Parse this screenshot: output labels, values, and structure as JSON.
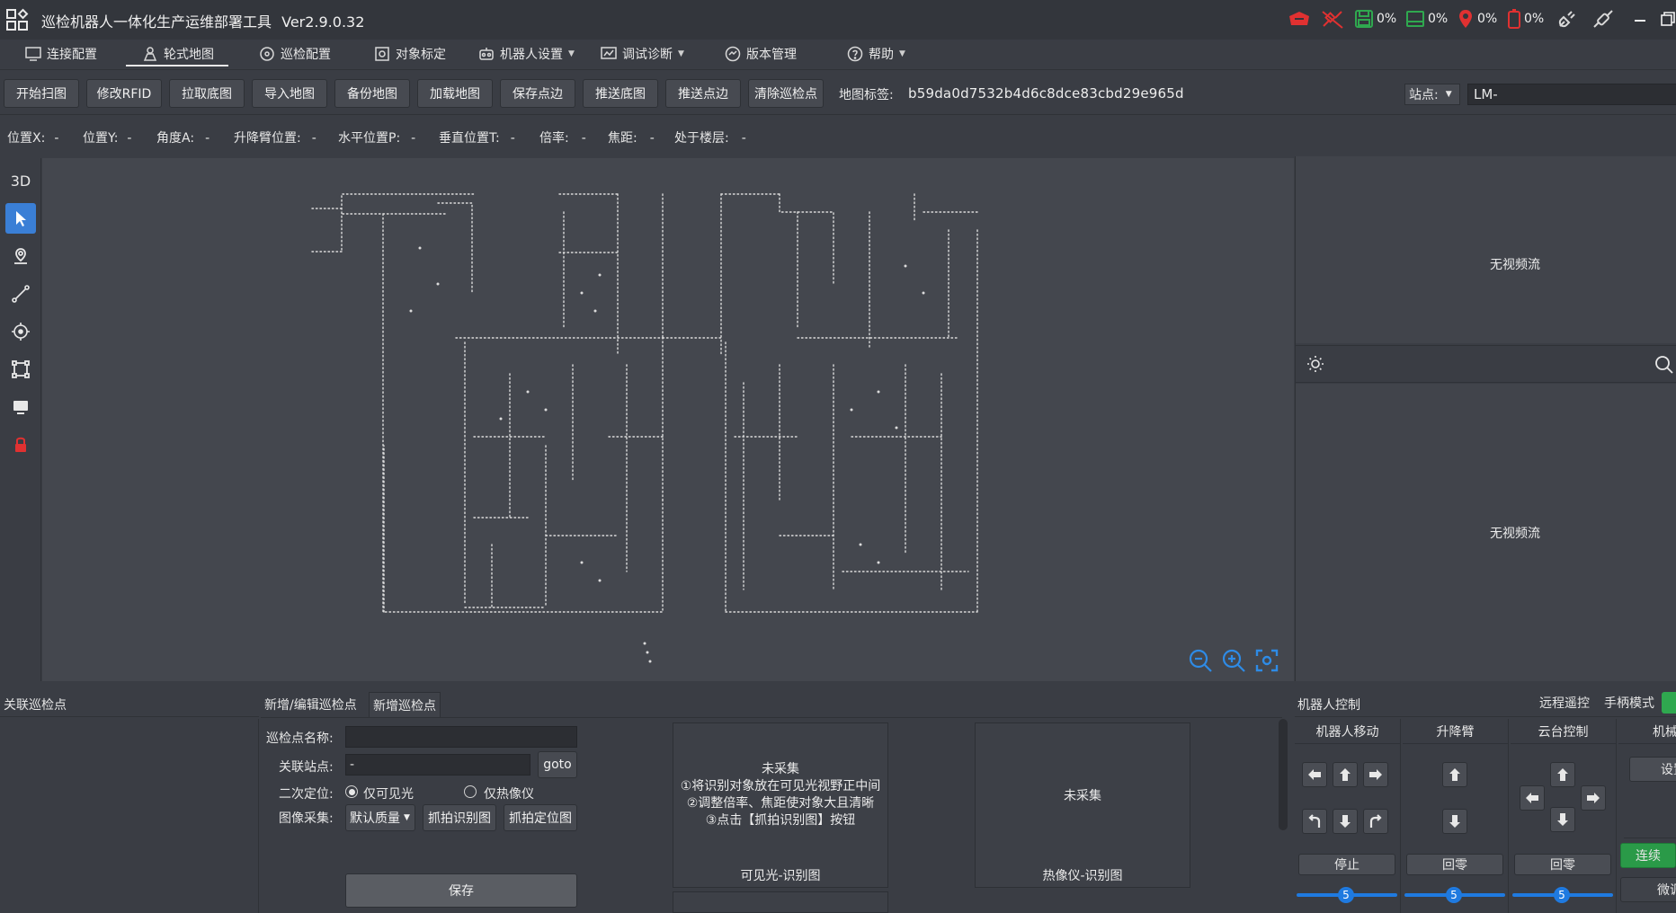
{
  "app": {
    "title": "巡检机器人一体化生产运维部署工具",
    "version": "Ver2.9.0.32"
  },
  "status_icons": [
    {
      "name": "alarm-icon",
      "color": "#e03131"
    },
    {
      "name": "disconnect-icon",
      "color": "#e03131"
    },
    {
      "name": "disk-icon",
      "value": "0%",
      "color": "#2fa84f"
    },
    {
      "name": "memory-icon",
      "value": "0%",
      "color": "#2fa84f"
    },
    {
      "name": "location-pin-icon",
      "value": "0%",
      "color": "#e03131"
    },
    {
      "name": "battery-icon",
      "value": "0%",
      "color": "#e03131"
    },
    {
      "name": "power-plug-icon"
    },
    {
      "name": "link-icon"
    }
  ],
  "menu": [
    {
      "label": "连接配置",
      "icon": "connection-icon"
    },
    {
      "label": "轮式地图",
      "icon": "robot-map-icon",
      "active": true
    },
    {
      "label": "巡检配置",
      "icon": "patrol-config-icon"
    },
    {
      "label": "对象标定",
      "icon": "target-icon"
    },
    {
      "label": "机器人设置",
      "icon": "robot-settings-icon",
      "dropdown": true
    },
    {
      "label": "调试诊断",
      "icon": "debug-icon",
      "dropdown": true
    },
    {
      "label": "版本管理",
      "icon": "version-icon"
    },
    {
      "label": "帮助",
      "icon": "help-icon",
      "dropdown": true
    }
  ],
  "toolbar": {
    "buttons": [
      "开始扫图",
      "修改RFID",
      "拉取底图",
      "导入地图",
      "备份地图",
      "加载地图",
      "保存点边",
      "推送底图",
      "推送点边",
      "清除巡检点"
    ],
    "map_tag_label": "地图标签:",
    "map_tag_value": "b59da0d7532b4d6c8dce83cbd29e965d",
    "station_label": "站点:",
    "station_value": "LM-"
  },
  "status_line": [
    {
      "label": "位置X:",
      "value": "-"
    },
    {
      "label": "位置Y:",
      "value": "-"
    },
    {
      "label": "角度A:",
      "value": "-"
    },
    {
      "label": "升降臂位置:",
      "value": "-"
    },
    {
      "label": "水平位置P:",
      "value": "-"
    },
    {
      "label": "垂直位置T:",
      "value": "-"
    },
    {
      "label": "倍率:",
      "value": "-"
    },
    {
      "label": "焦距:",
      "value": "-"
    },
    {
      "label": "处于楼层:",
      "value": "-"
    }
  ],
  "tools": {
    "view_3d": "3D"
  },
  "video": {
    "top_text": "无视频流",
    "bottom_text": "无视频流"
  },
  "left_panel": {
    "title": "关联巡检点"
  },
  "edit_panel": {
    "tabs": [
      "新增/编辑巡检点",
      "新增巡检点"
    ],
    "name_label": "巡检点名称:",
    "name_value": "",
    "station_label": "关联站点:",
    "station_value": "-",
    "goto_label": "goto",
    "relocate_label": "二次定位:",
    "radio_visible": "仅可见光",
    "radio_thermal": "仅热像仪",
    "capture_label": "图像采集:",
    "quality_value": "默认质量",
    "snap_recog_label": "抓拍识别图",
    "snap_locate_label": "抓拍定位图",
    "save_label": "保存",
    "visible_box": {
      "status": "未采集",
      "line1": "①将识别对象放在可见光视野正中间",
      "line2": "②调整倍率、焦距使对象大且清晰",
      "line3": "③点击【抓拍识别图】按钮",
      "caption": "可见光-识别图"
    },
    "thermal_box": {
      "status": "未采集",
      "caption": "热像仪-识别图"
    }
  },
  "robot_control": {
    "title": "机器人控制",
    "remote_label": "远程遥控",
    "joystick_label": "手柄模式",
    "move_title": "机器人移动",
    "lift_title": "升降臂",
    "ptz_title": "云台控制",
    "mech_title": "机械",
    "stop_label": "停止",
    "lift_zero_label": "回零",
    "ptz_zero_label": "回零",
    "settings_label": "设置",
    "continuous_label": "连续",
    "fine_label": "微调",
    "move_speed": "5",
    "lift_speed": "5",
    "ptz_speed": "5"
  }
}
